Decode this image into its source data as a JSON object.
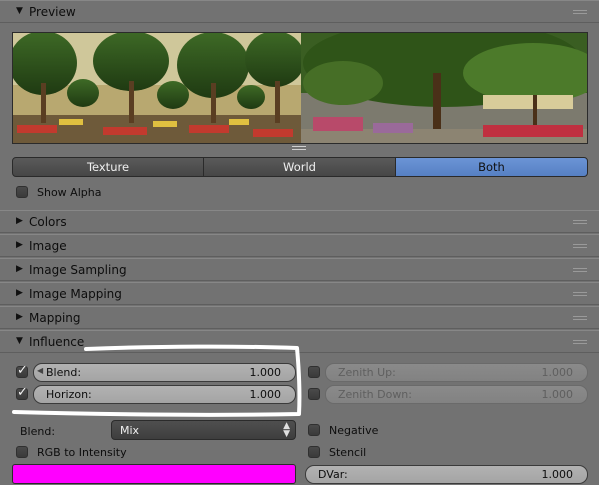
{
  "preview_panel": {
    "title": "Preview"
  },
  "mode_tabs": [
    {
      "label": "Texture"
    },
    {
      "label": "World"
    },
    {
      "label": "Both"
    }
  ],
  "show_alpha": {
    "label": "Show Alpha",
    "checked": false
  },
  "sections": [
    {
      "label": "Colors"
    },
    {
      "label": "Image"
    },
    {
      "label": "Image Sampling"
    },
    {
      "label": "Image Mapping"
    },
    {
      "label": "Mapping"
    }
  ],
  "influence": {
    "title": "Influence",
    "blend_field": {
      "label": "Blend:",
      "value": "1.000",
      "checked": true
    },
    "horizon_field": {
      "label": "Horizon:",
      "value": "1.000",
      "checked": true
    },
    "zenith_up_field": {
      "label": "Zenith Up:",
      "value": "1.000",
      "checked": false
    },
    "zenith_down_field": {
      "label": "Zenith Down:",
      "value": "1.000",
      "checked": false
    },
    "blend_mode": {
      "label": "Blend:",
      "value": "Mix"
    },
    "negative": {
      "label": "Negative",
      "checked": false
    },
    "rgb_to_intensity": {
      "label": "RGB to Intensity",
      "checked": false
    },
    "stencil": {
      "label": "Stencil",
      "checked": false
    },
    "color": "#ff00ff",
    "dvar": {
      "label": "DVar:",
      "value": "1.000"
    }
  },
  "colors": {
    "active_tab": "#5d87c9",
    "annotation": "#ffffff"
  }
}
